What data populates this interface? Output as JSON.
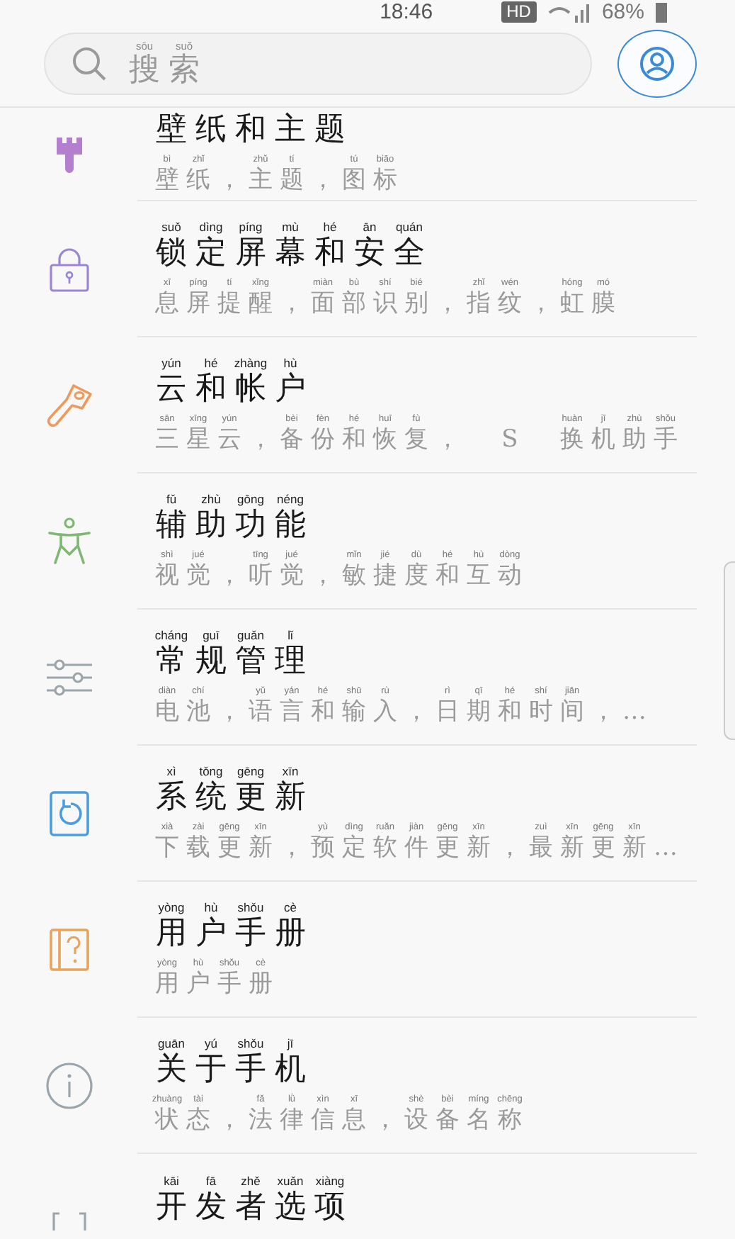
{
  "status_bar": {
    "time": "18:46",
    "hd_badge": "HD",
    "battery": "68%"
  },
  "search": {
    "placeholder_pinyin": "sōu suǒ",
    "placeholder": "搜索"
  },
  "items": [
    {
      "kind": "brush",
      "color": "#b57fd0",
      "title": "壁纸和主题",
      "subtitle_pinyin": "bì zhǐ zhǔ tí tú biāo",
      "subtitle": "壁纸，主题，图标"
    },
    {
      "kind": "lock",
      "color": "#9b86d6",
      "title_pinyin": "suǒ dìng píng mù hé ān quán",
      "title": "锁定屏幕和安全",
      "subtitle_pinyin": "xī píng tí xǐng miàn bù shí bié zhǐ wén hóng mó",
      "subtitle": "息屏提醒，面部识别，指纹，虹膜"
    },
    {
      "kind": "key",
      "color": "#ee9a5c",
      "title_pinyin": "yún hé zhàng hù",
      "title": "云和帐户",
      "subtitle_pinyin": "sān xīng yún bèi fèn hé huī fù huàn jī zhù shǒu",
      "subtitle": "三星云，备份和恢复， S 换机助手"
    },
    {
      "kind": "person",
      "color": "#7fb872",
      "title_pinyin": "fǔ zhù gōng néng",
      "title": "辅助功能",
      "subtitle_pinyin": "shì jué tīng jué mǐn jié dù hé hù dòng",
      "subtitle": "视觉，听觉，敏捷度和互动"
    },
    {
      "kind": "sliders",
      "color": "#9aa5ac",
      "title_pinyin": "cháng guī guǎn lǐ",
      "title": "常规管理",
      "subtitle_pinyin": "diàn chí yǔ yán hé shū rù rì qī hé shí jiān",
      "subtitle": "电池，语言和输入，日期和时间，…"
    },
    {
      "kind": "update",
      "color": "#4b9de0",
      "title_pinyin": "xì tǒng gēng xīn",
      "title": "系统更新",
      "subtitle_pinyin": "xià zài gēng xīn yù dìng ruǎn jiàn gēng xīn zuì xīn gēng xīn",
      "subtitle": "下载更新，预定软件更新，最新更新…"
    },
    {
      "kind": "manual",
      "color": "#e8a45a",
      "title_pinyin": "yòng hù shǒu cè",
      "title": "用户手册",
      "subtitle_pinyin": "yòng hù shǒu cè",
      "subtitle": "用户手册"
    },
    {
      "kind": "info",
      "color": "#9aa5ac",
      "title_pinyin": "guān yú shǒu jī",
      "title": "关于手机",
      "subtitle_pinyin": "zhuàng tài fǎ lǜ xìn xī shè bèi míng chēng",
      "subtitle": "状态，法律信息，设备名称"
    },
    {
      "kind": "braces",
      "color": "#9aa5ac",
      "title_pinyin": "kāi fā zhě xuǎn xiàng",
      "title": "开发者选项"
    }
  ]
}
